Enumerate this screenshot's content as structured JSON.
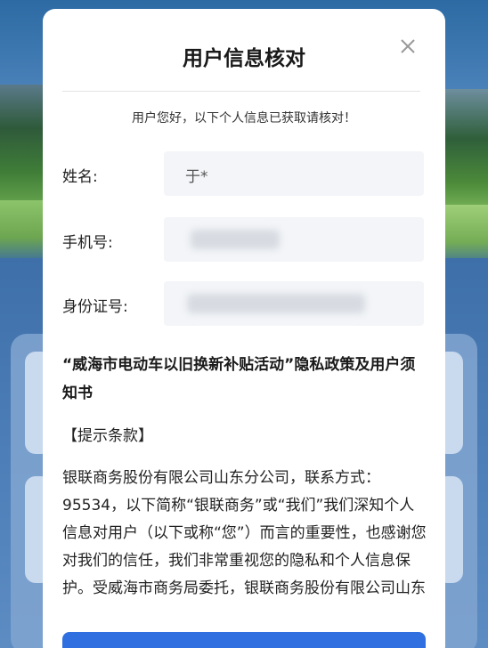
{
  "dialog": {
    "title": "用户信息核对",
    "notice": "用户您好，以下个人信息已获取请核对！",
    "close_icon": "close-icon"
  },
  "fields": [
    {
      "label": "姓名:",
      "value": "于*"
    },
    {
      "label": "手机号:",
      "value": ""
    },
    {
      "label": "身份证号:",
      "value": ""
    }
  ],
  "policy": {
    "title": "“威海市电动车以旧换新补贴活动”隐私政策及用户须知书",
    "section_head": "【提示条款】",
    "body": "银联商务股份有限公司山东分公司，联系方式：95534，以下简称“银联商务”或“我们”我们深知个人信息对用户（以下或称“您”）而言的重要性，也感谢您对我们的信任，我们非常重视您的隐私和个人信息保护。受威海市商务局委托，银联商务股份有限公司山东"
  },
  "colors": {
    "accent": "#2f6fe0",
    "field_bg": "#f3f5f8",
    "modal_bg": "#ffffff"
  }
}
